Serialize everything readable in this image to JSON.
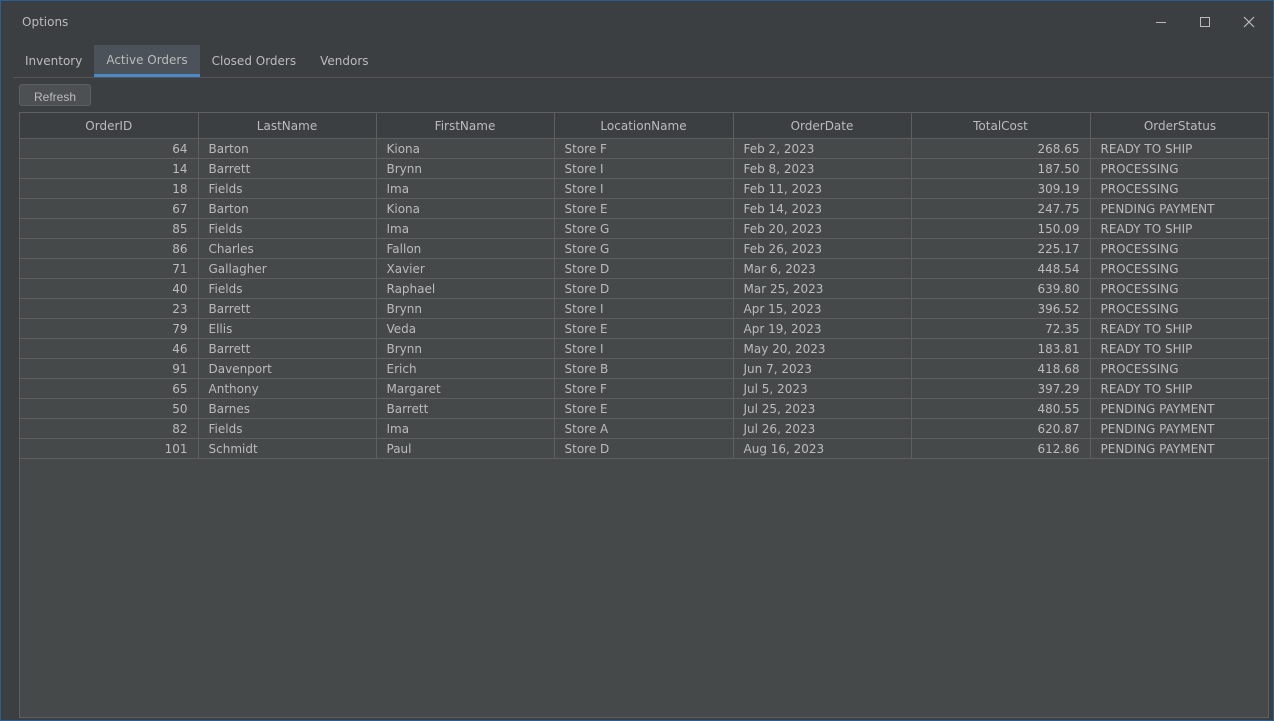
{
  "window": {
    "title": "Options"
  },
  "tabs": [
    {
      "label": "Inventory",
      "active": false
    },
    {
      "label": "Active Orders",
      "active": true
    },
    {
      "label": "Closed Orders",
      "active": false
    },
    {
      "label": "Vendors",
      "active": false
    }
  ],
  "toolbar": {
    "refresh_label": "Refresh"
  },
  "table": {
    "columns": [
      "OrderID",
      "LastName",
      "FirstName",
      "LocationName",
      "OrderDate",
      "TotalCost",
      "OrderStatus"
    ],
    "rows": [
      [
        "64",
        "Barton",
        "Kiona",
        "Store F",
        "Feb 2, 2023",
        "268.65",
        "READY TO SHIP"
      ],
      [
        "14",
        "Barrett",
        "Brynn",
        "Store I",
        "Feb 8, 2023",
        "187.50",
        "PROCESSING"
      ],
      [
        "18",
        "Fields",
        "Ima",
        "Store I",
        "Feb 11, 2023",
        "309.19",
        "PROCESSING"
      ],
      [
        "67",
        "Barton",
        "Kiona",
        "Store E",
        "Feb 14, 2023",
        "247.75",
        "PENDING PAYMENT"
      ],
      [
        "85",
        "Fields",
        "Ima",
        "Store G",
        "Feb 20, 2023",
        "150.09",
        "READY TO SHIP"
      ],
      [
        "86",
        "Charles",
        "Fallon",
        "Store G",
        "Feb 26, 2023",
        "225.17",
        "PROCESSING"
      ],
      [
        "71",
        "Gallagher",
        "Xavier",
        "Store D",
        "Mar 6, 2023",
        "448.54",
        "PROCESSING"
      ],
      [
        "40",
        "Fields",
        "Raphael",
        "Store D",
        "Mar 25, 2023",
        "639.80",
        "PROCESSING"
      ],
      [
        "23",
        "Barrett",
        "Brynn",
        "Store I",
        "Apr 15, 2023",
        "396.52",
        "PROCESSING"
      ],
      [
        "79",
        "Ellis",
        "Veda",
        "Store E",
        "Apr 19, 2023",
        "72.35",
        "READY TO SHIP"
      ],
      [
        "46",
        "Barrett",
        "Brynn",
        "Store I",
        "May 20, 2023",
        "183.81",
        "READY TO SHIP"
      ],
      [
        "91",
        "Davenport",
        "Erich",
        "Store B",
        "Jun 7, 2023",
        "418.68",
        "PROCESSING"
      ],
      [
        "65",
        "Anthony",
        "Margaret",
        "Store F",
        "Jul 5, 2023",
        "397.29",
        "READY TO SHIP"
      ],
      [
        "50",
        "Barnes",
        "Barrett",
        "Store E",
        "Jul 25, 2023",
        "480.55",
        "PENDING PAYMENT"
      ],
      [
        "82",
        "Fields",
        "Ima",
        "Store A",
        "Jul 26, 2023",
        "620.87",
        "PENDING PAYMENT"
      ],
      [
        "101",
        "Schmidt",
        "Paul",
        "Store D",
        "Aug 16, 2023",
        "612.86",
        "PENDING PAYMENT"
      ]
    ]
  },
  "colors": {
    "background": "#3c3f41",
    "table_background": "#45494a",
    "text": "#bbbbbb",
    "accent": "#4a88c7",
    "grid": "#5e6060"
  },
  "icons": {
    "minimize": "minimize-icon",
    "maximize": "maximize-icon",
    "close": "close-icon"
  }
}
